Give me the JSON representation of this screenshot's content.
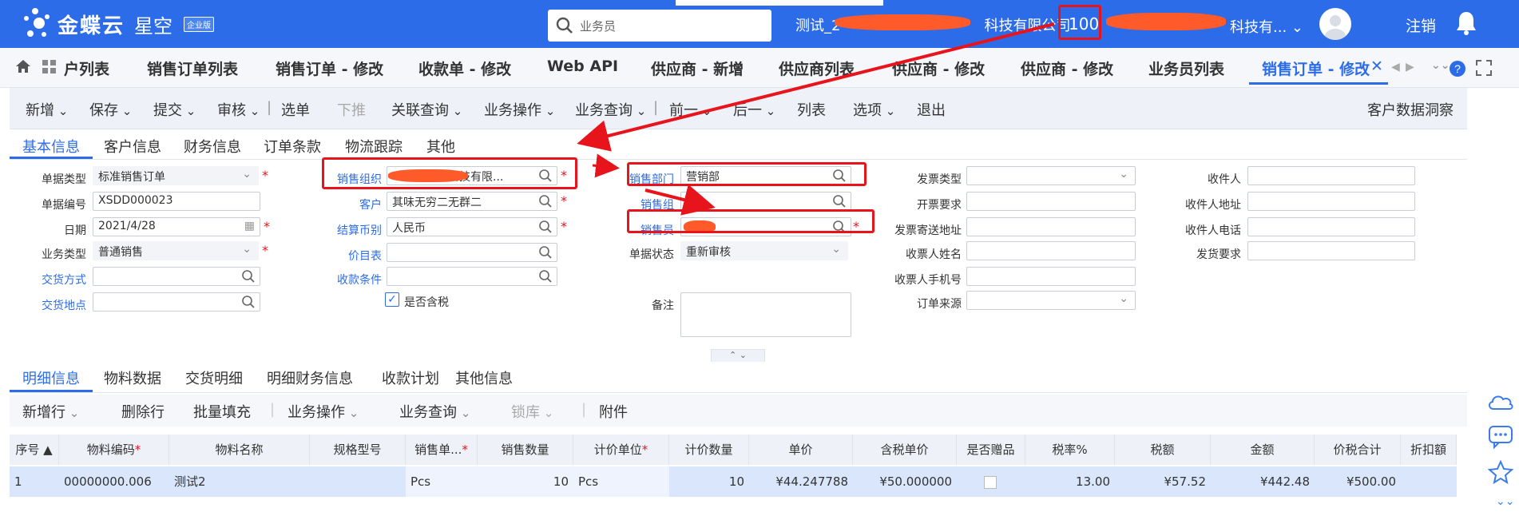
{
  "app": {
    "brand": "金蝶云",
    "brand2": "星空",
    "edition": "企业版",
    "search_placeholder": "业务员",
    "tenant": "测试_2",
    "tenant_suffix": "科技有限公司",
    "number": "100",
    "org_suffix": "科技有...",
    "logout": "注销"
  },
  "tabs": [
    "户列表",
    "销售订单列表",
    "销售订单 - 修改",
    "收款单 - 修改",
    "Web API",
    "供应商 - 新增",
    "供应商列表",
    "供应商 - 修改",
    "供应商 - 修改",
    "业务员列表",
    "销售订单 - 修改"
  ],
  "toolbar": [
    "新增",
    "保存",
    "提交",
    "审核",
    "选单",
    "下推",
    "关联查询",
    "业务操作",
    "业务查询",
    "前一",
    "后一",
    "列表",
    "选项",
    "退出"
  ],
  "toolbar_right": "客户数据洞察",
  "sections": [
    "基本信息",
    "客户信息",
    "财务信息",
    "订单条款",
    "物流跟踪",
    "其他"
  ],
  "form": {
    "doc_type_label": "单据类型",
    "doc_type": "标准销售订单",
    "doc_no_label": "单据编号",
    "doc_no": "XSDD000023",
    "date_label": "日期",
    "date": "2021/4/28",
    "biz_type_label": "业务类型",
    "biz_type": "普通销售",
    "delivery_method_label": "交货方式",
    "delivery_place_label": "交货地点",
    "sales_org_label": "销售组织",
    "sales_org": "科技有限...",
    "customer_label": "客户",
    "customer": "其味无穷二无群二",
    "currency_label": "结算币别",
    "currency": "人民币",
    "price_list_label": "价目表",
    "payment_terms_label": "收款条件",
    "tax_included_label": "是否含税",
    "sales_dept_label": "销售部门",
    "sales_dept": "营销部",
    "sales_group_label": "销售组",
    "salesman_label": "销售员",
    "salesman": "",
    "status_label": "单据状态",
    "status": "重新审核",
    "remark_label": "备注",
    "invoice_type_label": "发票类型",
    "invoice_req_label": "开票要求",
    "invoice_addr_label": "发票寄送地址",
    "invoice_name_label": "收票人姓名",
    "invoice_phone_label": "收票人手机号",
    "order_source_label": "订单来源",
    "receiver_label": "收件人",
    "receiver_addr_label": "收件人地址",
    "receiver_phone_label": "收件人电话",
    "ship_req_label": "发货要求"
  },
  "detail_tabs": [
    "明细信息",
    "物料数据",
    "交货明细",
    "明细财务信息",
    "收款计划",
    "其他信息"
  ],
  "detail_toolbar": [
    "新增行",
    "删除行",
    "批量填充",
    "业务操作",
    "业务查询",
    "锁库",
    "附件"
  ],
  "columns": [
    "序号",
    "物料编码",
    "物料名称",
    "规格型号",
    "销售单...",
    "销售数量",
    "计价单位",
    "计价数量",
    "单价",
    "含税单价",
    "是否赠品",
    "税率%",
    "税额",
    "金额",
    "价税合计",
    "折扣額"
  ],
  "row": [
    "1",
    "00000000.006",
    "测试2",
    "",
    "Pcs",
    "10",
    "Pcs",
    "10",
    "¥44.247788",
    "¥50.000000",
    "",
    "13.00",
    "¥57.52",
    "¥442.48",
    "¥500.00",
    ""
  ]
}
